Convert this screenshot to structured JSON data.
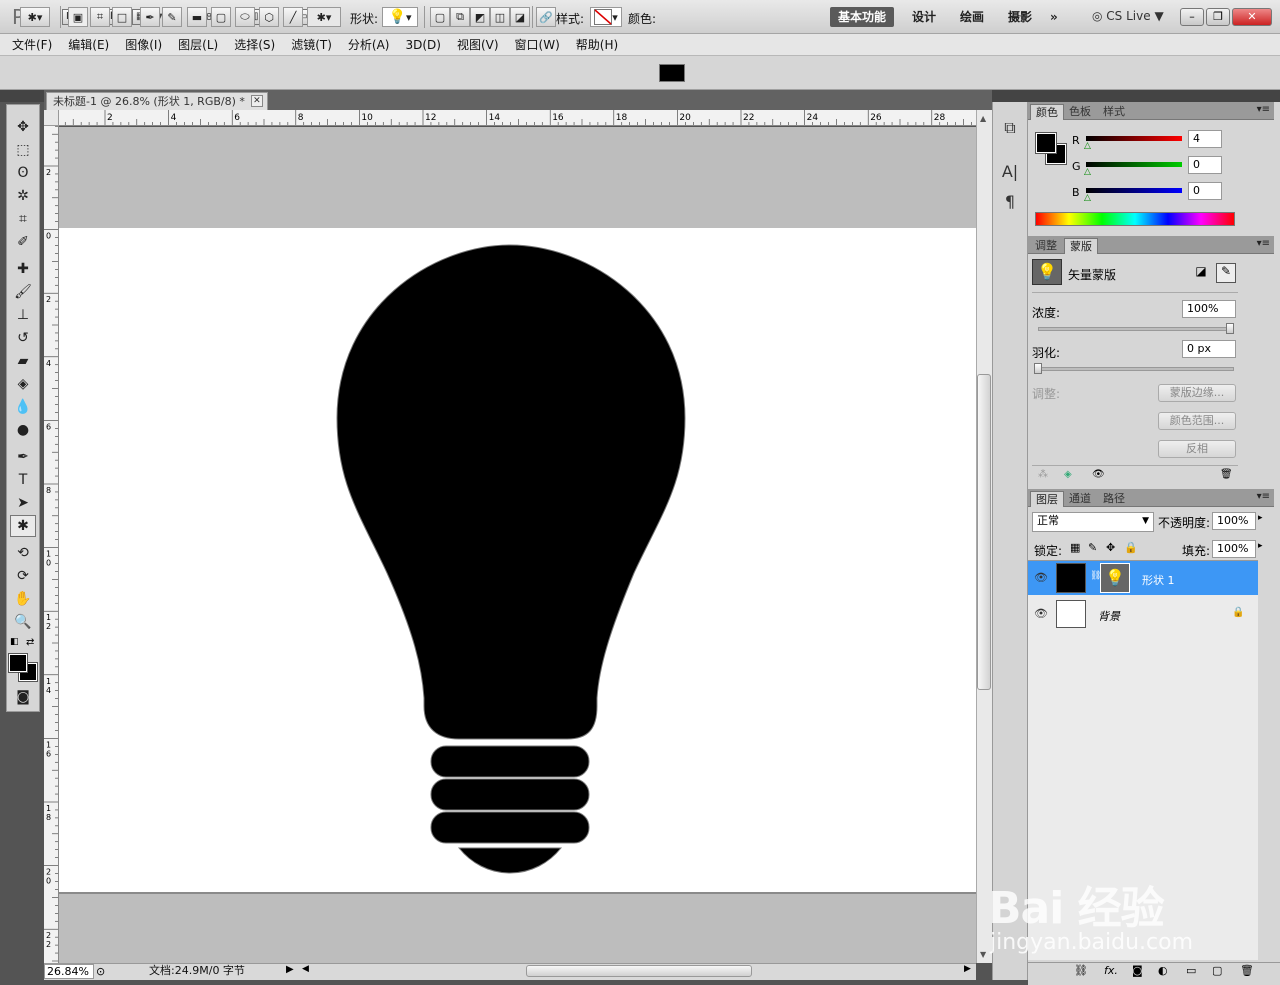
{
  "app": {
    "logo": "Ps",
    "bridge_btn": "Br",
    "mini_bridge_btn": "Mb",
    "zoom_value": "26.8",
    "workspaces": [
      "基本功能",
      "设计",
      "绘画",
      "摄影"
    ],
    "more_workspaces": "»",
    "cs_live": "CS Live"
  },
  "menu": [
    "文件(F)",
    "编辑(E)",
    "图像(I)",
    "图层(L)",
    "选择(S)",
    "滤镜(T)",
    "分析(A)",
    "3D(D)",
    "视图(V)",
    "窗口(W)",
    "帮助(H)"
  ],
  "options": {
    "shape_label": "形状:",
    "style_label": "样式:",
    "color_label": "颜色:",
    "color_value": "#000000"
  },
  "document": {
    "tab_title": "未标题-1 @ 26.8% (形状 1, RGB/8) *",
    "ruler_h": [
      "2",
      "4",
      "6",
      "8",
      "10",
      "12",
      "14",
      "16",
      "18",
      "20",
      "22",
      "24",
      "26",
      "28"
    ],
    "ruler_v": [
      "2",
      "0",
      "2",
      "4",
      "6",
      "8",
      "10",
      "12",
      "14",
      "16",
      "18",
      "20",
      "22"
    ],
    "zoom": "26.84%",
    "doc_info": "文档:24.9M/0 字节"
  },
  "color_panel": {
    "tabs": [
      "颜色",
      "色板",
      "样式"
    ],
    "r_label": "R",
    "g_label": "G",
    "b_label": "B",
    "r_value": "4",
    "g_value": "0",
    "b_value": "0",
    "foreground": "#000000",
    "background": "#000000"
  },
  "masks_panel": {
    "tabs": [
      "调整",
      "蒙版"
    ],
    "title": "矢量蒙版",
    "density_label": "浓度:",
    "density_value": "100%",
    "feather_label": "羽化:",
    "feather_value": "0 px",
    "refine_label": "调整:",
    "mask_edge_btn": "蒙版边缘...",
    "color_range_btn": "颜色范围...",
    "invert_btn": "反相"
  },
  "layers_panel": {
    "tabs": [
      "图层",
      "通道",
      "路径"
    ],
    "blend_mode": "正常",
    "opacity_label": "不透明度:",
    "opacity_value": "100%",
    "lock_label": "锁定:",
    "fill_label": "填充:",
    "fill_value": "100%",
    "layers": [
      {
        "name": "形状 1",
        "selected": true
      },
      {
        "name": "背景",
        "selected": false
      }
    ]
  },
  "watermark": {
    "line1": "Bai 经验",
    "line2": "jingyan.baidu.com"
  }
}
